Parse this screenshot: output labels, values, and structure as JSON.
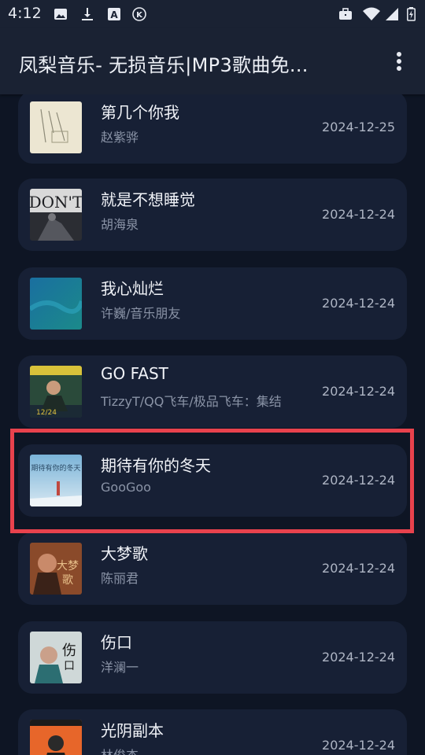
{
  "status_bar": {
    "time": "4:12",
    "left_icons": [
      "image-icon",
      "download-icon",
      "a-badge-icon",
      "k-circle-icon"
    ],
    "right_icons": [
      "briefcase-icon",
      "wifi-icon",
      "signal-icon",
      "battery-icon"
    ]
  },
  "app_bar": {
    "title": "凤梨音乐- 无损音乐|MP3歌曲免...",
    "menu_icon": "more-vert-icon"
  },
  "songs": [
    {
      "title": "第几个你我",
      "artist": "赵紫骅",
      "date": "2024-12-25"
    },
    {
      "title": "就是不想睡觉",
      "artist": "胡海泉",
      "date": "2024-12-24"
    },
    {
      "title": "我心灿烂",
      "artist": "许巍/音乐朋友",
      "date": "2024-12-24"
    },
    {
      "title": "GO FAST",
      "artist": "TizzyT/QQ飞车/极品飞车：集结",
      "date": "2024-12-24"
    },
    {
      "title": "期待有你的冬天",
      "artist": "GooGoo",
      "date": "2024-12-24"
    },
    {
      "title": "大梦歌",
      "artist": "陈丽君",
      "date": "2024-12-24"
    },
    {
      "title": "伤口",
      "artist": "洋澜一",
      "date": "2024-12-24"
    },
    {
      "title": "光阴副本",
      "artist": "林俊杰",
      "date": "2024-12-24"
    }
  ],
  "colors": {
    "background": "#0e1524",
    "row_background": "#172035",
    "app_bar": "#1a2233",
    "highlight": "#e8424d"
  }
}
